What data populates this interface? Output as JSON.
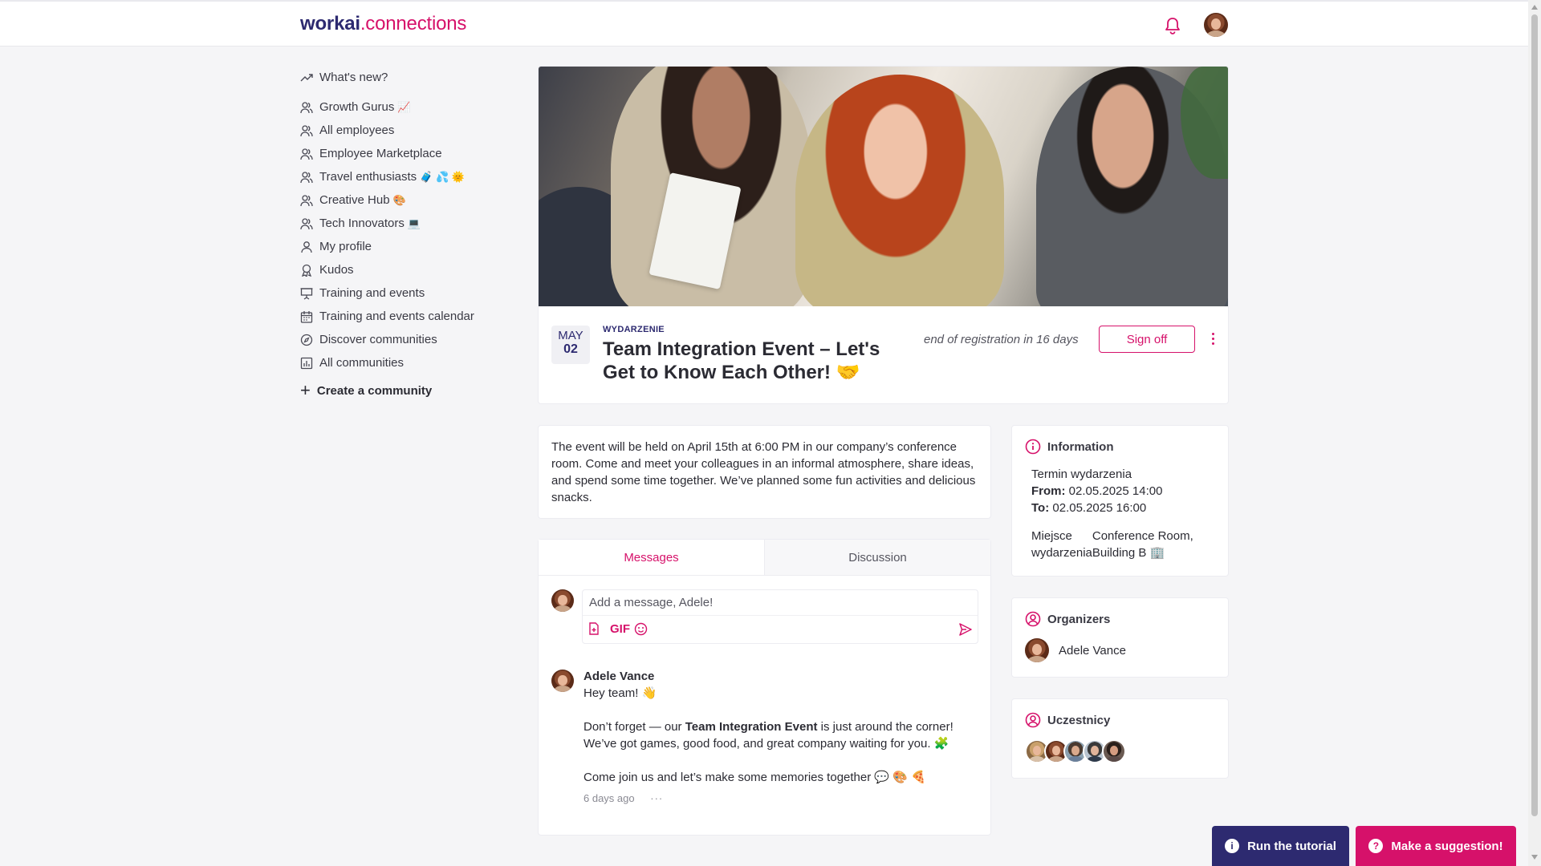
{
  "header": {
    "logo_part1": "workai",
    "logo_part2": ".connections"
  },
  "sidebar": {
    "items": [
      {
        "label": "What's new?",
        "icon": "trending-up-icon",
        "emoji": ""
      },
      {
        "label": "Growth Gurus",
        "icon": "users-icon",
        "emoji": "📈"
      },
      {
        "label": "All employees",
        "icon": "users-icon",
        "emoji": ""
      },
      {
        "label": "Employee Marketplace",
        "icon": "users-icon",
        "emoji": ""
      },
      {
        "label": "Travel enthusiasts",
        "icon": "users-icon",
        "emoji": "🧳 💦 🌞"
      },
      {
        "label": "Creative Hub",
        "icon": "users-icon",
        "emoji": "🎨"
      },
      {
        "label": "Tech Innovators",
        "icon": "users-icon",
        "emoji": "💻"
      },
      {
        "label": "My profile",
        "icon": "user-icon",
        "emoji": ""
      },
      {
        "label": "Kudos",
        "icon": "award-icon",
        "emoji": ""
      },
      {
        "label": "Training and events",
        "icon": "presentation-icon",
        "emoji": ""
      },
      {
        "label": "Training and events calendar",
        "icon": "calendar-icon",
        "emoji": ""
      },
      {
        "label": "Discover communities",
        "icon": "compass-icon",
        "emoji": ""
      },
      {
        "label": "All communities",
        "icon": "bar-chart-icon",
        "emoji": ""
      }
    ],
    "create_label": "Create a community"
  },
  "event": {
    "month": "MAY",
    "day": "02",
    "type": "WYDARZENIE",
    "title": "Team Integration Event – Let's Get to Know Each Other! 🤝",
    "registration": "end of registration in 16 days",
    "signoff_label": "Sign off",
    "description": "The event will be held on April 15th at 6:00 PM in our company’s conference room. Come and meet your colleagues in an informal atmosphere, share ideas, and spend some time together. We’ve planned some fun activities and delicious snacks."
  },
  "tabs": {
    "messages": "Messages",
    "discussion": "Discussion"
  },
  "compose": {
    "placeholder": "Add a message, Adele!",
    "gif_label": "GIF"
  },
  "message": {
    "author": "Adele Vance",
    "line1": "Hey team! 👋",
    "line2_pre": "Don’t forget — our ",
    "line2_bold": "Team Integration Event",
    "line2_post": " is just around the corner! We’ve got games, good food, and great company waiting for you. 🧩",
    "line3": "Come join us and let’s make some memories together 💬 🎨 🍕",
    "time": "6 days ago",
    "more": "···"
  },
  "information": {
    "heading": "Information",
    "term_label": "Termin wydarzenia",
    "from_label": "From:",
    "from_value": "02.05.2025 14:00",
    "to_label": "To:",
    "to_value": "02.05.2025 16:00",
    "place_label": "Miejsce wydarzenia",
    "place_value": "Conference Room, Building B 🏢"
  },
  "organizers": {
    "heading": "Organizers",
    "name": "Adele Vance"
  },
  "participants": {
    "heading": "Uczestnicy"
  },
  "buttons": {
    "tutorial": "Run the tutorial",
    "suggestion": "Make a suggestion!"
  },
  "colors": {
    "brand": "#2d2a70",
    "accent": "#d6116a"
  }
}
